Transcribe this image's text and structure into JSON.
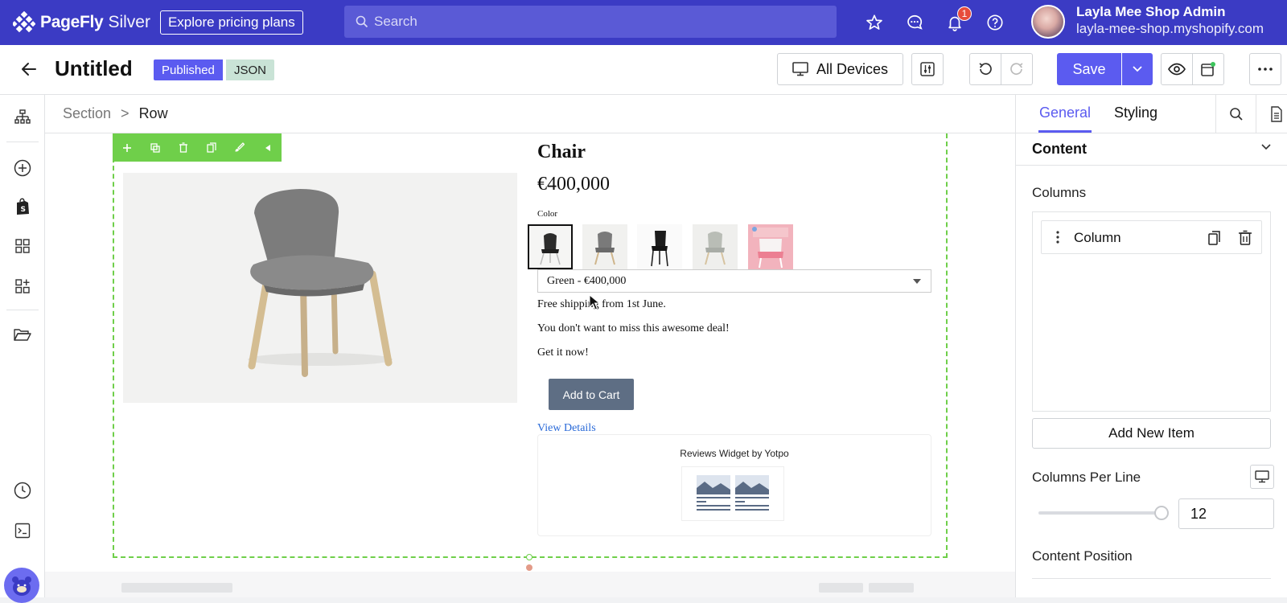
{
  "brand": {
    "name": "PageFly",
    "tier": "Silver",
    "pricing_label": "Explore pricing plans"
  },
  "search": {
    "placeholder": "Search"
  },
  "topbar": {
    "notifications_count": "1",
    "account_name": "Layla Mee Shop Admin",
    "account_shop": "layla-mee-shop.myshopify.com"
  },
  "page": {
    "title": "Untitled",
    "status": "Published",
    "format": "JSON"
  },
  "toolbar": {
    "devices_label": "All Devices",
    "save_label": "Save"
  },
  "breadcrumb": {
    "items": [
      "Section",
      "Row"
    ],
    "separator": ">"
  },
  "product": {
    "title": "Chair",
    "price": "€400,000",
    "color_label": "Color",
    "variant_selected": "Green - €400,000",
    "lines": [
      "Free shipping from 1st June.",
      "You don't want to miss this awesome deal!",
      "Get it now!"
    ],
    "add_to_cart": "Add to Cart",
    "view_details": "View Details",
    "reviews_widget": "Reviews Widget by Yotpo"
  },
  "panel": {
    "tabs": [
      "General",
      "Styling"
    ],
    "section": "Content",
    "columns_label": "Columns",
    "column_item": "Column",
    "add_item": "Add New Item",
    "columns_per_line_label": "Columns Per Line",
    "columns_per_line_value": "12",
    "content_position_label": "Content Position"
  },
  "colors": {
    "accent": "#5b5bf0",
    "topbar": "#3b3bc4",
    "selection": "#6fcf4a",
    "button": "#5e6e84",
    "link": "#2a6ad8"
  }
}
